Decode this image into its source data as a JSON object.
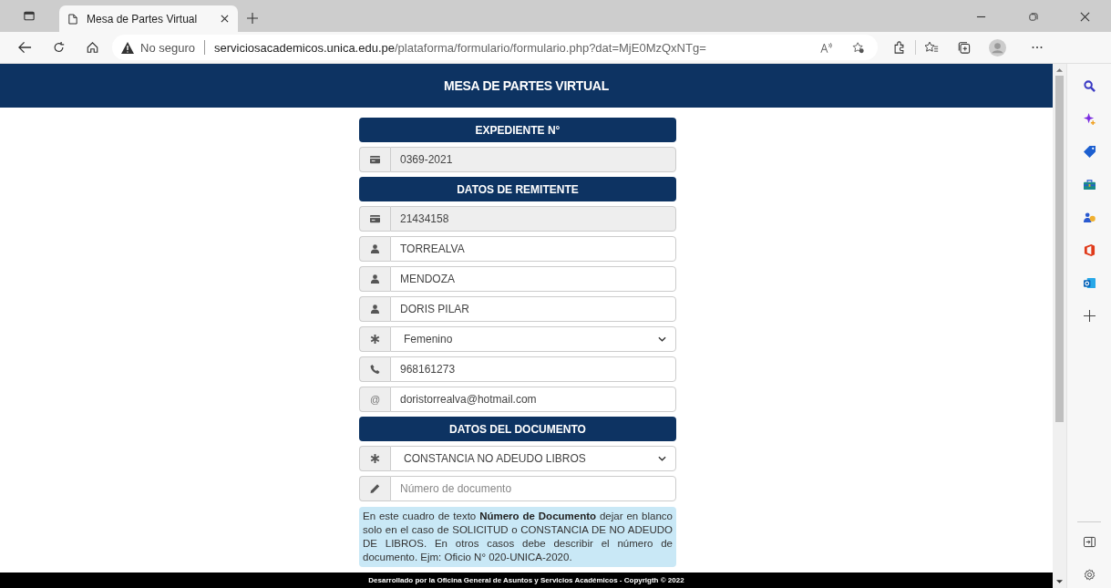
{
  "browser": {
    "tab_title": "Mesa de Partes Virtual",
    "security": "No seguro",
    "url_host": "serviciosacademicos.unica.edu.pe",
    "url_path": "/plataforma/formulario/formulario.php?dat=MjE0MzQxNTg="
  },
  "page": {
    "title": "MESA DE PARTES VIRTUAL",
    "items": [
      {
        "kind": "header",
        "text": "**EXPEDIENTE N°**"
      },
      {
        "kind": "id",
        "value": "0369-2021",
        "disabled": true
      },
      {
        "kind": "header",
        "text": "**DATOS DE REMITENTE**"
      },
      {
        "kind": "id",
        "value": "21434158",
        "disabled": true
      },
      {
        "kind": "person",
        "value": "TORREALVA",
        "disabled": false
      },
      {
        "kind": "person",
        "value": "MENDOZA",
        "disabled": false
      },
      {
        "kind": "person",
        "value": "DORIS PILAR",
        "disabled": false
      },
      {
        "kind": "select",
        "value": "Femenino"
      },
      {
        "kind": "phone",
        "value": "968161273",
        "disabled": false
      },
      {
        "kind": "email",
        "prefix": "@",
        "value": "doristorrealva@hotmail.com",
        "disabled": false
      },
      {
        "kind": "header",
        "text": "**DATOS DEL DOCUMENTO**"
      },
      {
        "kind": "select",
        "value": "CONSTANCIA NO ADEUDO LIBROS"
      },
      {
        "kind": "pencil",
        "placeholder": "Número de documento",
        "disabled": false
      },
      {
        "kind": "note",
        "text": "En este cuadro de texto **Número de Documento** dejar en blanco solo en el caso de SOLICITUD o CONSTANCIA DE NO ADEUDO DE LIBROS. En otros casos debe describir el número de documento. Ejm: Oficio N° 020-UNICA-2020."
      }
    ],
    "footer": "Desarrollado por la Oficina General de Asuntos y Servicios Académicos - Copyrigth © 2022"
  }
}
